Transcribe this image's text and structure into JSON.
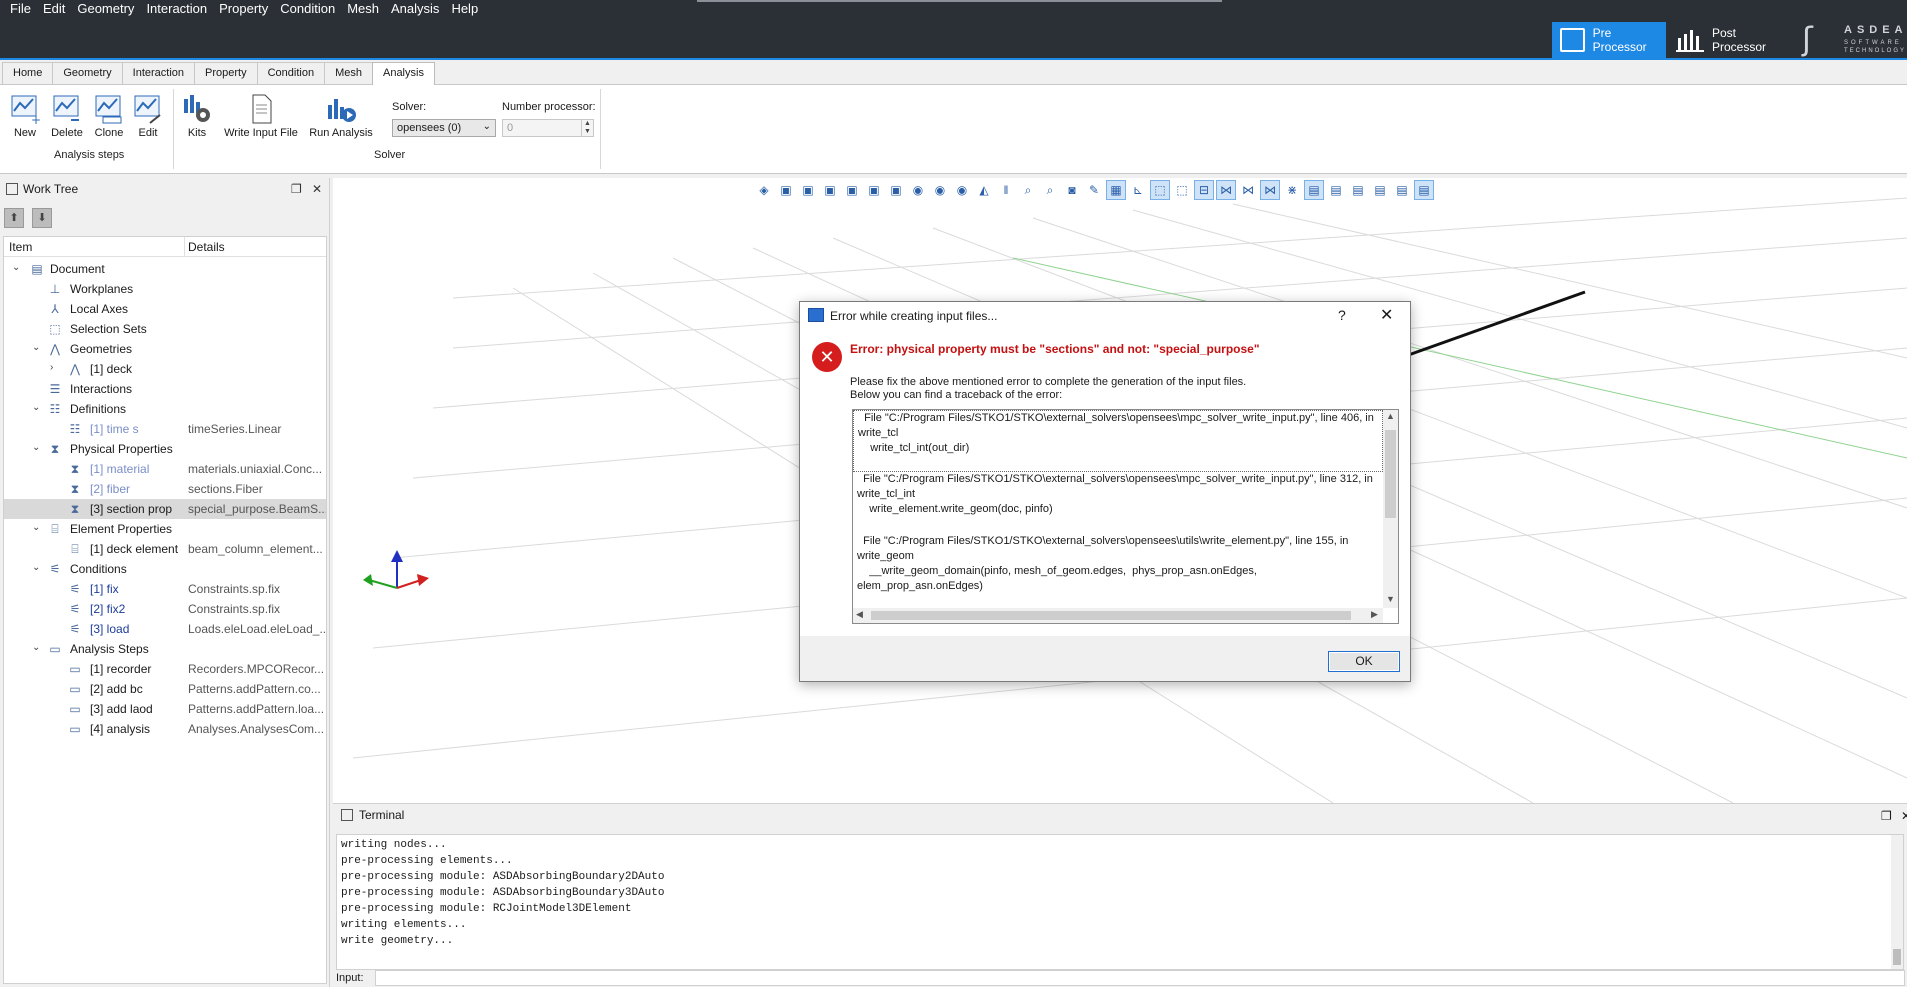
{
  "menu": [
    "File",
    "Edit",
    "Geometry",
    "Interaction",
    "Property",
    "Condition",
    "Mesh",
    "Analysis",
    "Help"
  ],
  "processors": {
    "pre": "Pre Processor",
    "post": "Post Processor"
  },
  "logo": {
    "line1": "ASDEA",
    "line2": "SOFTWARE",
    "line3": "TECHNOLOGY"
  },
  "ribbon": {
    "tabs": [
      "Home",
      "Geometry",
      "Interaction",
      "Property",
      "Condition",
      "Mesh",
      "Analysis"
    ],
    "active_tab": "Analysis",
    "analysis_steps": {
      "new": "New",
      "delete": "Delete",
      "clone": "Clone",
      "edit": "Edit",
      "group": "Analysis steps"
    },
    "solver_group": {
      "kits": "Kits",
      "write_input": "Write Input File",
      "run": "Run Analysis",
      "group": "Solver"
    },
    "solver_label": "Solver:",
    "solver_value": "opensees (0)",
    "nproc_label": "Number processor:",
    "nproc_value": "0"
  },
  "worktree": {
    "title": "Work Tree",
    "col_item": "Item",
    "col_details": "Details",
    "rows": [
      {
        "label": "Document",
        "details": ""
      },
      {
        "label": "Workplanes",
        "details": ""
      },
      {
        "label": "Local Axes",
        "details": ""
      },
      {
        "label": "Selection Sets",
        "details": ""
      },
      {
        "label": "Geometries",
        "details": ""
      },
      {
        "label": "[1] deck",
        "details": ""
      },
      {
        "label": "Interactions",
        "details": ""
      },
      {
        "label": "Definitions",
        "details": ""
      },
      {
        "label": "[1] time s",
        "details": "timeSeries.Linear"
      },
      {
        "label": "Physical Properties",
        "details": ""
      },
      {
        "label": "[1] material",
        "details": "materials.uniaxial.Conc..."
      },
      {
        "label": "[2] fiber",
        "details": "sections.Fiber"
      },
      {
        "label": "[3] section prop",
        "details": "special_purpose.BeamS..."
      },
      {
        "label": "Element Properties",
        "details": ""
      },
      {
        "label": "[1] deck element",
        "details": "beam_column_element..."
      },
      {
        "label": "Conditions",
        "details": ""
      },
      {
        "label": "[1] fix",
        "details": "Constraints.sp.fix"
      },
      {
        "label": "[2] fix2",
        "details": "Constraints.sp.fix"
      },
      {
        "label": "[3] load",
        "details": "Loads.eleLoad.eleLoad_..."
      },
      {
        "label": "Analysis Steps",
        "details": ""
      },
      {
        "label": "[1] recorder",
        "details": "Recorders.MPCORecor..."
      },
      {
        "label": "[2] add bc",
        "details": "Patterns.addPattern.co..."
      },
      {
        "label": "[3] add laod",
        "details": "Patterns.addPattern.loa..."
      },
      {
        "label": "[4] analysis",
        "details": "Analyses.AnalysesCom..."
      }
    ]
  },
  "dialog": {
    "title": "Error while creating input files...",
    "help": "?",
    "close": "✕",
    "error": "Error: physical property must be \"sections\" and not: \"special_purpose\"",
    "sub1": "Please fix the above mentioned error to complete the generation of the input files.",
    "sub2": "Below you can find a traceback of the error:",
    "trace1": "  File \"C:/Program Files/STKO1/STKO\\external_solvers\\opensees\\mpc_solver_write_input.py\", line 406, in\nwrite_tcl\n    write_tcl_int(out_dir)",
    "trace2": "  File \"C:/Program Files/STKO1/STKO\\external_solvers\\opensees\\mpc_solver_write_input.py\", line 312, in\nwrite_tcl_int\n    write_element.write_geom(doc, pinfo)",
    "trace3": "  File \"C:/Program Files/STKO1/STKO\\external_solvers\\opensees\\utils\\write_element.py\", line 155, in\nwrite_geom\n    __write_geom_domain(pinfo, mesh_of_geom.edges,  phys_prop_asn.onEdges,\nelem_prop_asn.onEdges)",
    "ok": "OK"
  },
  "terminal": {
    "title": "Terminal",
    "lines": [
      "writing nodes...",
      "pre-processing elements...",
      "pre-processing module: ASDAbsorbingBoundary2DAuto",
      "pre-processing module: ASDAbsorbingBoundary3DAuto",
      "pre-processing module: RCJointModel3DElement",
      "writing elements...",
      "write geometry..."
    ],
    "input_label": "Input:"
  }
}
